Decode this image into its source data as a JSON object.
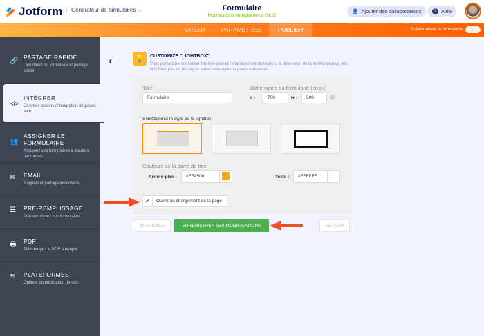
{
  "header": {
    "logo": "Jotform",
    "builder": "Générateur de formulaires",
    "form_title": "Formulaire",
    "save_status": "Modifications enregistrées à 08:22",
    "add_collab": "Ajouter des collaborateurs",
    "help": "Aide"
  },
  "tabs": [
    {
      "label": "CRÉER"
    },
    {
      "label": "PARAMÈTRES"
    },
    {
      "label": "PUBLIER"
    }
  ],
  "preview_toggle": "Prévisualiser le formulaire",
  "sidebar": {
    "items": [
      {
        "title": "PARTAGE RAPIDE",
        "desc": "Lien direct du formulaire et partage social"
      },
      {
        "title": "INTÉGRER",
        "desc": "Diverses options d'intégration de pages web."
      },
      {
        "title": "ASSIGNER LE FORMULAIRE",
        "desc": "Assignez vos formulaires à d'autres personnes"
      },
      {
        "title": "EMAIL",
        "desc": "Rappels et partage instantané."
      },
      {
        "title": "PRÉ-REMPLISSAGE",
        "desc": "Pré-remplissez vos formulaires"
      },
      {
        "title": "PDF",
        "desc": "Téléchargez le PDF à remplir."
      },
      {
        "title": "PLATEFORMES",
        "desc": "Options de publication tierces."
      }
    ]
  },
  "customize": {
    "title": "CUSTOMIZE \"LIGHTBOX\"",
    "desc": "Vous pouvez personnaliser l'arrière-plan et l'emplacement du bouton, la dimension de la fenêtre pop-up, etc. N'oubliez pas de réintégrer votre code après la personnalisation."
  },
  "form": {
    "title_label": "Titre",
    "title_value": "Formulaire",
    "dims_label": "Dimensions du formulaire (en px)",
    "w_label": "L :",
    "w_value": "700",
    "h_label": "H :",
    "h_value": "500",
    "style_label": "Sélectionnez le style de la lightbox",
    "colors_label": "Couleurs de la barre de titre",
    "bg_label": "Arrière-plan :",
    "bg_value": "#FFA500",
    "text_label": "Texte :",
    "text_value": "#FFFFFF",
    "open_on_load": "Ouvrir au chargement de la page",
    "open_on_load_checked": true
  },
  "buttons": {
    "preview": "APERÇU",
    "save": "ENREGISTRER LES MODIFICATIONS",
    "back": "RETOUR"
  },
  "colors": {
    "accent": "#ff6100",
    "save": "#4caf50",
    "swatch_bg": "#FFA500",
    "swatch_text": "#FFFFFF"
  }
}
